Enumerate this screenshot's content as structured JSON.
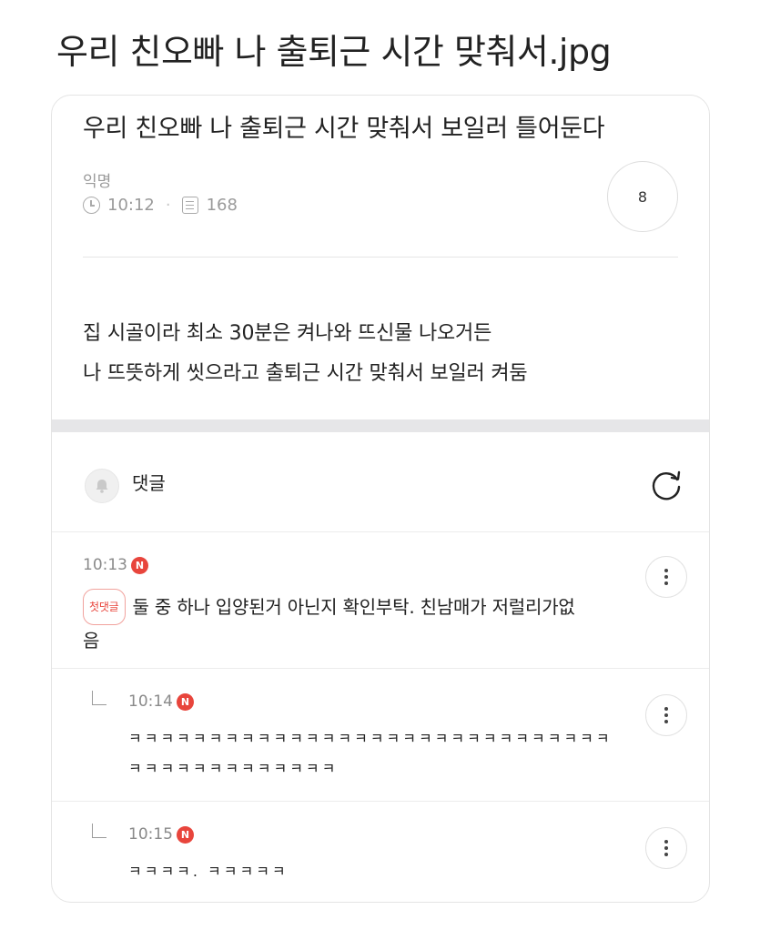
{
  "page_title": "우리 친오빠 나 출퇴근 시간 맞춰서.jpg",
  "post": {
    "title": "우리 친오빠 나 출퇴근 시간 맞춰서 보일러 틀어둔다",
    "author": "익명",
    "time": "10:12",
    "separator": "·",
    "views": "168",
    "likes": "8",
    "body_lines": [
      "집 시골이라 최소 30분은 켜나와 뜨신물 나오거든",
      "나 뜨뜻하게 씻으라고 출퇴근 시간 맞춰서 보일러 켜둠"
    ]
  },
  "comments_section": {
    "label": "댓글",
    "icons": {
      "bell": "bell-icon",
      "refresh": "refresh-icon"
    }
  },
  "comments": [
    {
      "time": "10:13",
      "new_badge": "N",
      "first_badge": "첫댓글",
      "text_line1": "둘 중 하나 입양된거 아닌지 확인부탁. 친남매가 저럴리가없",
      "text_line2": "음"
    },
    {
      "time": "10:14",
      "new_badge": "N",
      "text_line1": "ㅋㅋㅋㅋㅋㅋㅋㅋㅋㅋㅋㅋㅋㅋㅋㅋㅋㅋㅋㅋㅋㅋㅋㅋㅋㅋㅋㅋㅋㅋ",
      "text_line2": "ㅋㅋㅋㅋㅋㅋㅋㅋㅋㅋㅋㅋㅋ"
    },
    {
      "time": "10:15",
      "new_badge": "N",
      "text_line1": "ㅋㅋㅋㅋ.   ㅋㅋㅋㅋㅋ"
    }
  ],
  "colors": {
    "accent": "#e8453c",
    "muted": "#9a9a9a",
    "band": "#e6e6e8"
  }
}
